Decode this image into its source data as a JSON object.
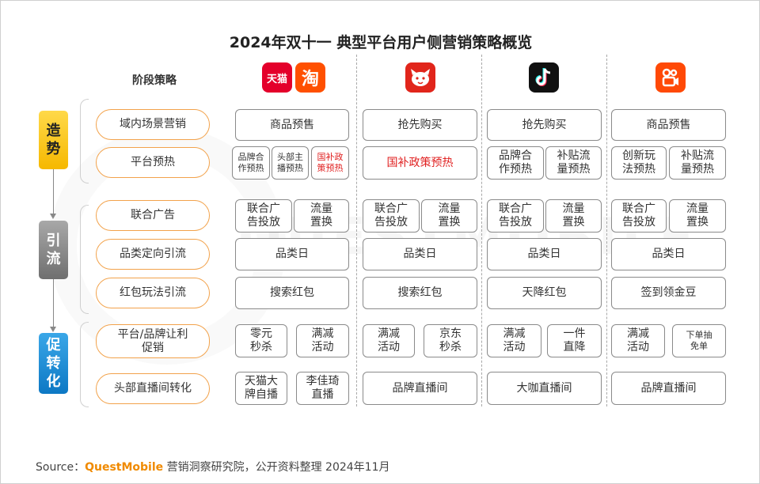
{
  "title": "2024年双十一 典型平台用户侧营销策略概览",
  "header_label": "阶段策略",
  "watermark": "QUESTMOBILE",
  "platform_logos": [
    {
      "name": "tmall-logo",
      "text": "天猫",
      "color": "#e4002b"
    },
    {
      "name": "taobao-logo",
      "text": "淘",
      "color": "#ff5000"
    },
    {
      "name": "jd-logo",
      "icon": "jd-dog-icon",
      "color": "#e1251b"
    },
    {
      "name": "douyin-logo",
      "icon": "douyin-note-icon",
      "color": "#111111"
    },
    {
      "name": "kuaishou-logo",
      "icon": "kuaishou-camera-icon",
      "color": "#ff4906"
    }
  ],
  "phases": [
    {
      "label": "造\n势",
      "color": "#f6b800"
    },
    {
      "label": "引\n流",
      "color": "#6f6f6f"
    },
    {
      "label": "促\n转\n化",
      "color": "#0d78c4"
    }
  ],
  "strategies": [
    "域内场景营销",
    "平台预热",
    "联合广告",
    "品类定向引流",
    "红包玩法引流",
    "平台/品牌让利\n促销",
    "头部直播间转化"
  ],
  "cells": {
    "tmall": {
      "r0": [
        "商品预售"
      ],
      "r1": [
        "品牌合\n作预热",
        "头部主\n播预热",
        "国补政\n策预热"
      ],
      "r2": [
        "联合广\n告投放",
        "流量\n置换"
      ],
      "r3": [
        "品类日"
      ],
      "r4": [
        "搜索红包"
      ],
      "r5": [
        "零元\n秒杀",
        "满减\n活动"
      ],
      "r6": [
        "天猫大\n牌自播",
        "李佳琦\n直播"
      ]
    },
    "jd": {
      "r0": [
        "抢先购买"
      ],
      "r1": [
        "国补政策预热"
      ],
      "r2": [
        "联合广\n告投放",
        "流量\n置换"
      ],
      "r3": [
        "品类日"
      ],
      "r4": [
        "搜索红包"
      ],
      "r5": [
        "满减\n活动",
        "京东\n秒杀"
      ],
      "r6": [
        "品牌直播间"
      ]
    },
    "douyin": {
      "r0": [
        "抢先购买"
      ],
      "r1": [
        "品牌合\n作预热",
        "补贴流\n量预热"
      ],
      "r2": [
        "联合广\n告投放",
        "流量\n置换"
      ],
      "r3": [
        "品类日"
      ],
      "r4": [
        "天降红包"
      ],
      "r5": [
        "满减\n活动",
        "一件\n直降"
      ],
      "r6": [
        "大咖直播间"
      ]
    },
    "kuaishou": {
      "r0": [
        "商品预售"
      ],
      "r1": [
        "创新玩\n法预热",
        "补贴流\n量预热"
      ],
      "r2": [
        "联合广\n告投放",
        "流量\n置换"
      ],
      "r3": [
        "品类日"
      ],
      "r4": [
        "签到领金豆"
      ],
      "r5": [
        "满减\n活动",
        "下单抽\n免单"
      ],
      "r6": [
        "品牌直播间"
      ]
    }
  },
  "source": {
    "prefix": "Source：",
    "brand": "QuestMobile",
    "suffix": " 营销洞察研究院，公开资料整理 2024年11月"
  }
}
